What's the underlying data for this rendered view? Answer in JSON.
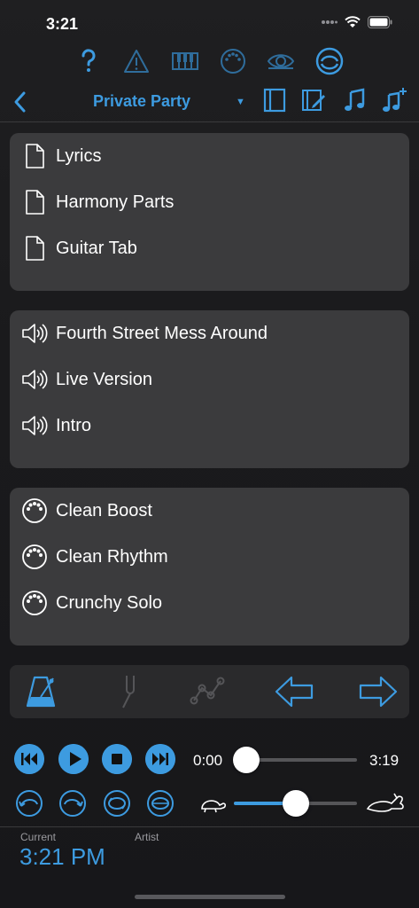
{
  "status_bar": {
    "time": "3:21"
  },
  "toolbar": {
    "icons": [
      "help-icon",
      "warning-icon",
      "keyboard-icon",
      "midi-icon",
      "eye-icon",
      "sync-icon"
    ]
  },
  "nav": {
    "title": "Private Party",
    "dropdown_glyph": "▼"
  },
  "documents": {
    "items": [
      {
        "label": "Lyrics"
      },
      {
        "label": "Harmony Parts"
      },
      {
        "label": "Guitar Tab"
      }
    ]
  },
  "audio": {
    "items": [
      {
        "label": "Fourth Street Mess Around"
      },
      {
        "label": "Live Version"
      },
      {
        "label": "Intro"
      }
    ]
  },
  "midi": {
    "items": [
      {
        "label": "Clean Boost"
      },
      {
        "label": "Clean Rhythm"
      },
      {
        "label": "Crunchy Solo"
      }
    ]
  },
  "transport": {
    "current_time": "0:00",
    "total_time": "3:19",
    "position_fraction": 0.0,
    "speed_fraction": 0.5
  },
  "footer": {
    "current_label": "Current",
    "current_value": "3:21 PM",
    "artist_label": "Artist",
    "artist_value": ""
  },
  "colors": {
    "accent": "#3d9be0",
    "dim_icon": "#2f6d9c",
    "card": "#3b3b3d"
  }
}
